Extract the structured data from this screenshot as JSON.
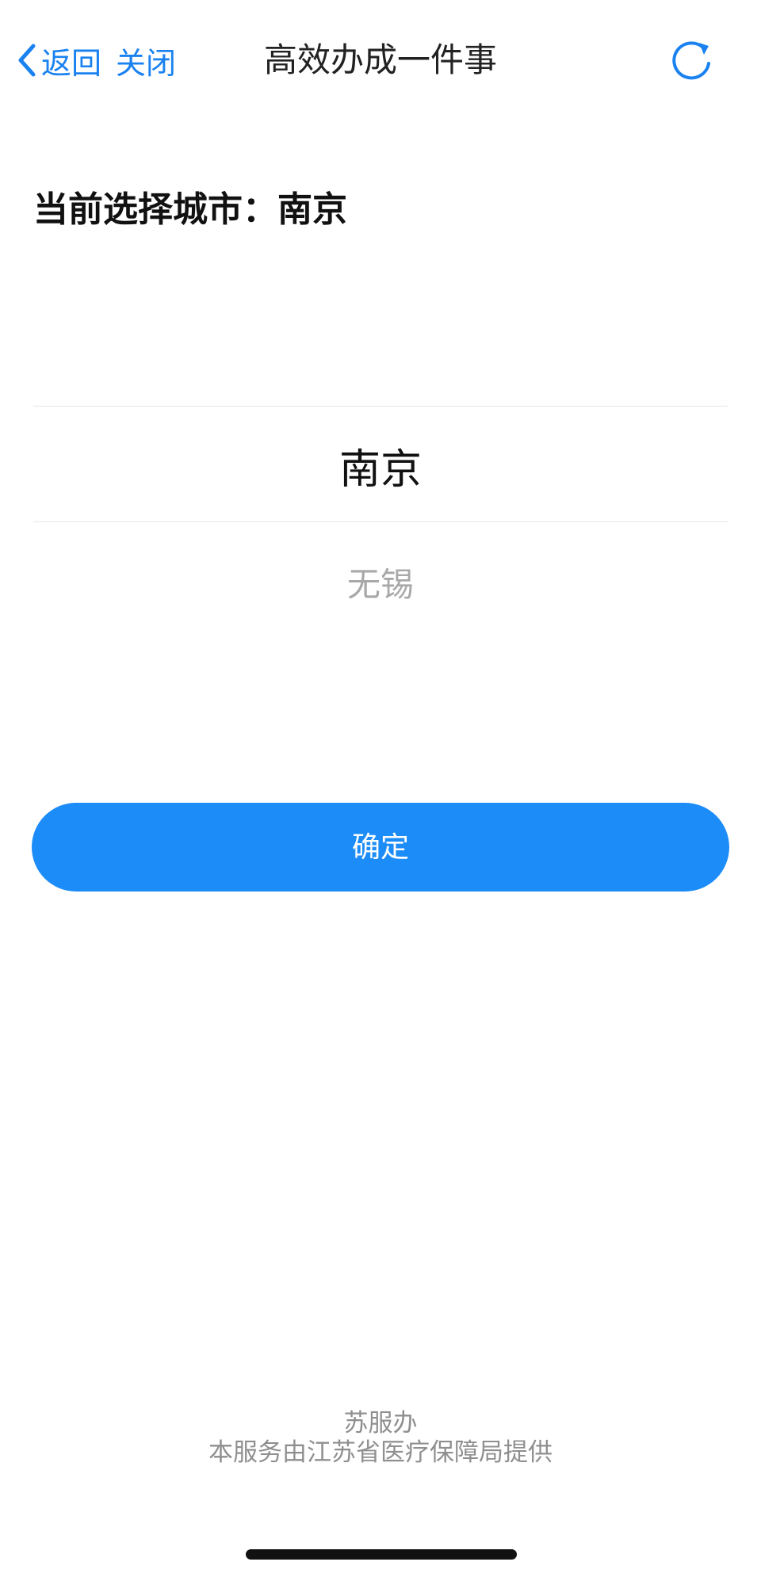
{
  "nav": {
    "back_label": "返回",
    "close_label": "关闭",
    "title": "高效办成一件事",
    "accent_color": "#1a82f0",
    "back_icon": "chevron-left-icon",
    "refresh_icon": "refresh-icon"
  },
  "current_city": {
    "label": "当前选择城市：南京"
  },
  "picker": {
    "options": [
      {
        "label": "南京",
        "selected": true
      },
      {
        "label": "无锡",
        "selected": false
      }
    ]
  },
  "confirm": {
    "label": "确定",
    "color": "#1c8cf8"
  },
  "footer": {
    "brand": "苏服办",
    "provider": "本服务由江苏省医疗保障局提供"
  }
}
